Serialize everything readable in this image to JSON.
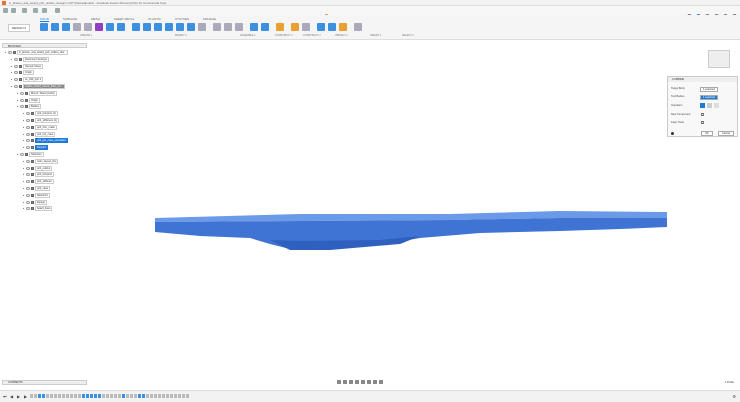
{
  "window_title": "ic_kirsten_ana_board_pcb_outline_designs v40* (Dell-adjusted) - Autodesk Fusion Personal (Not for Commercial Use)",
  "doc_tab": "ic_kirsten_ana_board_pcb_outline_designs v40*",
  "workspace": "DESIGN ▾",
  "ribbon_tabs": [
    "SOLID",
    "SURFACE",
    "MESH",
    "SHEET METAL",
    "PLASTIC",
    "UTILITIES",
    "MANAGE"
  ],
  "groups": [
    "CREATE ▾",
    "MODIFY ▾",
    "ASSEMBLE ▾",
    "CONSTRUCT ▾",
    "INSPECT ▾",
    "INSERT ▾",
    "SELECT ▾"
  ],
  "browser": {
    "title": "BROWSER",
    "nodes": [
      {
        "label": "ic_kirsten_ana_board_pcb_outline_des...",
        "lvl": 0
      },
      {
        "label": "Document Settings",
        "lvl": 1
      },
      {
        "label": "Named Views",
        "lvl": 1
      },
      {
        "label": "Origin",
        "lvl": 1
      },
      {
        "label": "ss_040_pcb:1",
        "lvl": 1
      },
      {
        "label": "outline_board_mount_float_ext...",
        "lvl": 1,
        "state": "hl"
      },
      {
        "label": "Mount: Stand (cubic)",
        "lvl": 2
      },
      {
        "label": "Origin",
        "lvl": 2
      },
      {
        "label": "Bodies",
        "lvl": 2
      },
      {
        "label": "pcb_footprint (1)",
        "lvl": 3
      },
      {
        "label": "pcb_stiffeners (1)",
        "lvl": 3
      },
      {
        "label": "pcb_thru_mask",
        "lvl": 3
      },
      {
        "label": "pcb_top_case",
        "lvl": 3
      },
      {
        "label": "pcb_tpu_case_simulated",
        "lvl": 3,
        "state": "sel"
      },
      {
        "label": "Body23",
        "lvl": 3,
        "state": "sel"
      },
      {
        "label": "Sketches",
        "lvl": 2
      },
      {
        "label": "main_layout_line",
        "lvl": 3
      },
      {
        "label": "pcb_outline",
        "lvl": 3
      },
      {
        "label": "pcb_footprint",
        "lvl": 3
      },
      {
        "label": "pcb_stiffener",
        "lvl": 3
      },
      {
        "label": "pcb_case",
        "lvl": 3
      },
      {
        "label": "Sketch21",
        "lvl": 3
      },
      {
        "label": "Design",
        "lvl": 3
      },
      {
        "label": "board_lines",
        "lvl": 3
      }
    ]
  },
  "combine": {
    "title": "COMBINE",
    "target_label": "Target Body",
    "target_value": "1 selected",
    "tool_label": "Tool Bodies",
    "tool_value": "1 selected",
    "operation_label": "Operation",
    "new_component_label": "New Component",
    "keep_tools_label": "Keep Tools",
    "ok": "OK",
    "cancel": "Cancel"
  },
  "comments": "COMMENTS",
  "status": "1 Profile",
  "colors": {
    "accent": "#1e7ad6",
    "body": "#4a7fd8"
  }
}
